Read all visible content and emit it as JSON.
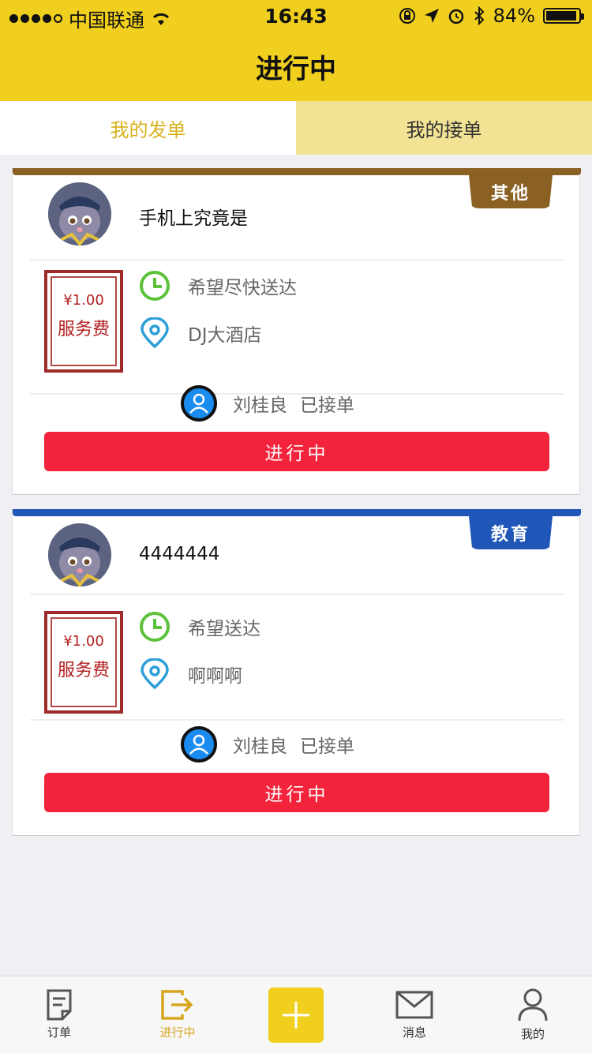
{
  "status_bar": {
    "carrier": "中国联通",
    "time": "16:43",
    "battery": "84%"
  },
  "navbar": {
    "title": "进行中"
  },
  "segments": {
    "left": "我的发单",
    "right": "我的接单"
  },
  "orders": [
    {
      "category": "其他",
      "category_color": "#8a6123",
      "title": "手机上究竟是",
      "price": "¥1.00",
      "fee_label": "服务费",
      "time_text": "希望尽快送达",
      "location": "DJ大酒店",
      "acceptor": "刘桂良",
      "accept_status": "已接单",
      "button": "进行中"
    },
    {
      "category": "教育",
      "category_color": "#1f56b8",
      "title": "4444444",
      "price": "¥1.00",
      "fee_label": "服务费",
      "time_text": "希望送达",
      "location": "啊啊啊",
      "acceptor": "刘桂良",
      "accept_status": "已接单",
      "button": "进行中"
    }
  ],
  "tabbar": {
    "items": [
      "订单",
      "进行中",
      "",
      "消息",
      "我的"
    ]
  },
  "colors": {
    "brand_yellow": "#f0cf1e",
    "button_red": "#f2233a",
    "active_tab": "#d8a51f"
  }
}
